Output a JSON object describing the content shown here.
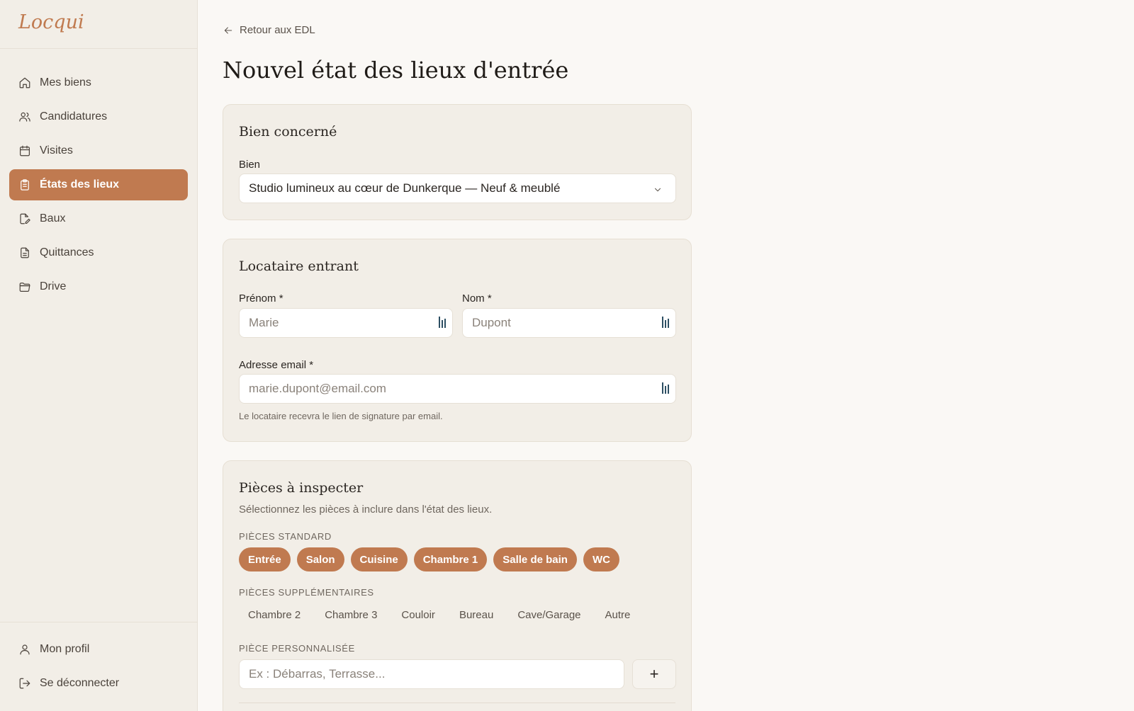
{
  "app": {
    "logo": "Locqui"
  },
  "sidebar": {
    "items": [
      {
        "label": "Mes biens",
        "icon": "home-icon"
      },
      {
        "label": "Candidatures",
        "icon": "users-icon"
      },
      {
        "label": "Visites",
        "icon": "calendar-icon"
      },
      {
        "label": "États des lieux",
        "icon": "clipboard-icon",
        "active": true
      },
      {
        "label": "Baux",
        "icon": "document-edit-icon"
      },
      {
        "label": "Quittances",
        "icon": "receipt-icon"
      },
      {
        "label": "Drive",
        "icon": "folder-icon"
      }
    ],
    "footer": [
      {
        "label": "Mon profil",
        "icon": "user-icon"
      },
      {
        "label": "Se déconnecter",
        "icon": "logout-icon"
      }
    ]
  },
  "header": {
    "back_label": "Retour aux EDL",
    "title": "Nouvel état des lieux d'entrée"
  },
  "bien_card": {
    "title": "Bien concerné",
    "field_label": "Bien",
    "selected_value": "Studio lumineux au cœur de Dunkerque — Neuf & meublé"
  },
  "locataire_card": {
    "title": "Locataire entrant",
    "prenom_label": "Prénom *",
    "prenom_placeholder": "Marie",
    "nom_label": "Nom *",
    "nom_placeholder": "Dupont",
    "email_label": "Adresse email *",
    "email_placeholder": "marie.dupont@email.com",
    "hint": "Le locataire recevra le lien de signature par email."
  },
  "pieces_card": {
    "title": "Pièces à inspecter",
    "subtitle": "Sélectionnez les pièces à inclure dans l'état des lieux.",
    "standard_label": "PIÈCES STANDARD",
    "standard": [
      "Entrée",
      "Salon",
      "Cuisine",
      "Chambre 1",
      "Salle de bain",
      "WC"
    ],
    "extra_label": "PIÈCES SUPPLÉMENTAIRES",
    "extra": [
      "Chambre 2",
      "Chambre 3",
      "Couloir",
      "Bureau",
      "Cave/Garage",
      "Autre"
    ],
    "custom_label": "PIÈCE PERSONNALISÉE",
    "custom_placeholder": "Ex : Débarras, Terrasse...",
    "add_label": "+"
  },
  "colors": {
    "accent": "#c07a50",
    "sidebar_bg": "#f2eee7",
    "page_bg": "#faf8f5"
  }
}
